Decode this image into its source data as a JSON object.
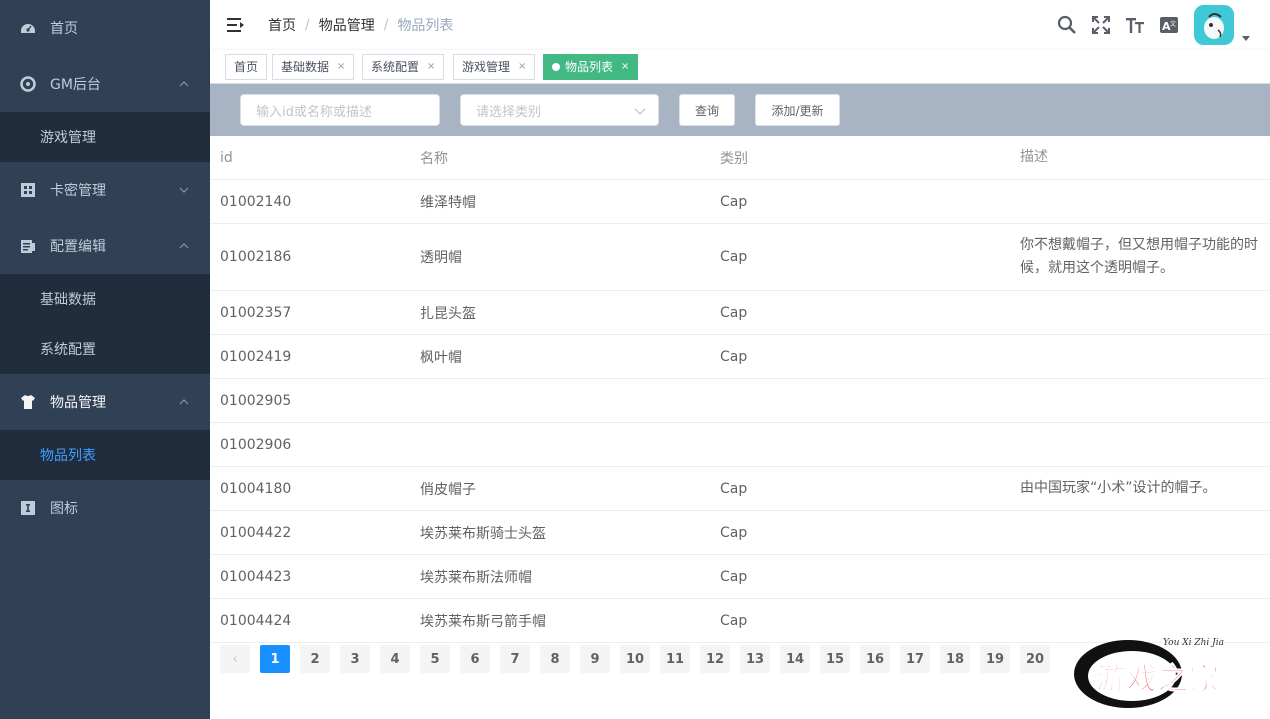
{
  "sidebar": {
    "items": [
      {
        "label": "首页",
        "icon": "dashboard-icon"
      },
      {
        "label": "GM后台",
        "icon": "gear-icon",
        "children": [
          {
            "label": "游戏管理"
          }
        ]
      },
      {
        "label": "卡密管理",
        "icon": "grid-icon"
      },
      {
        "label": "配置编辑",
        "icon": "edit-icon",
        "children": [
          {
            "label": "基础数据"
          },
          {
            "label": "系统配置"
          }
        ]
      },
      {
        "label": "物品管理",
        "icon": "shirt-icon",
        "children": [
          {
            "label": "物品列表"
          }
        ]
      },
      {
        "label": "图标",
        "icon": "image-icon"
      }
    ]
  },
  "navbar": {
    "breadcrumb": [
      "首页",
      "物品管理",
      "物品列表"
    ],
    "right_icons": [
      "search-icon",
      "fullscreen-icon",
      "font-size-icon",
      "translate-icon"
    ]
  },
  "tags": [
    {
      "label": "首页",
      "closable": false
    },
    {
      "label": "基础数据",
      "closable": true
    },
    {
      "label": "系统配置",
      "closable": true
    },
    {
      "label": "游戏管理",
      "closable": true
    },
    {
      "label": "物品列表",
      "closable": true,
      "active": true
    }
  ],
  "filter": {
    "search_placeholder": "输入id或名称或描述",
    "category_placeholder": "请选择类别",
    "query_label": "查询",
    "add_label": "添加/更新"
  },
  "table": {
    "headers": [
      "id",
      "名称",
      "类别",
      "描述"
    ],
    "rows": [
      [
        "01002140",
        "维泽特帽",
        "Cap",
        ""
      ],
      [
        "01002186",
        "透明帽",
        "Cap",
        "你不想戴帽子，但又想用帽子功能的时候，就用这个透明帽子。"
      ],
      [
        "01002357",
        "扎昆头盔",
        "Cap",
        ""
      ],
      [
        "01002419",
        "枫叶帽",
        "Cap",
        ""
      ],
      [
        "01002905",
        "",
        "",
        ""
      ],
      [
        "01002906",
        "",
        "",
        ""
      ],
      [
        "01004180",
        "俏皮帽子",
        "Cap",
        "由中国玩家“小术”设计的帽子。"
      ],
      [
        "01004422",
        "埃苏莱布斯骑士头盔",
        "Cap",
        ""
      ],
      [
        "01004423",
        "埃苏莱布斯法师帽",
        "Cap",
        ""
      ],
      [
        "01004424",
        "埃苏莱布斯弓箭手帽",
        "Cap",
        ""
      ]
    ]
  },
  "pagination": {
    "prev": "‹",
    "current": 1,
    "pages": [
      "1",
      "2",
      "3",
      "4",
      "5",
      "6",
      "7",
      "8",
      "9",
      "10",
      "11",
      "12",
      "13",
      "14",
      "15",
      "16",
      "17",
      "18",
      "19",
      "20"
    ]
  },
  "watermark": {
    "chinese": "游戏之家",
    "pinyin": "You Xi Zhi Jia"
  }
}
